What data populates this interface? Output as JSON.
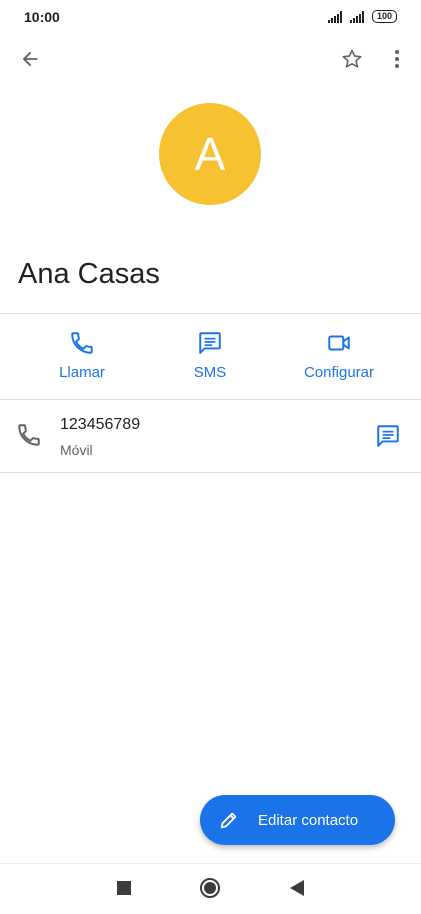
{
  "status_bar": {
    "time": "10:00",
    "battery": "100",
    "icons": [
      "signal-icon",
      "signal-icon",
      "battery-icon"
    ]
  },
  "appbar": {
    "icons": [
      "back-arrow-icon",
      "star-outline-icon",
      "more-vert-icon"
    ]
  },
  "contact": {
    "initial": "A",
    "name": "Ana Casas",
    "avatar_color": "#F6C232"
  },
  "actions": [
    {
      "label": "Llamar",
      "icon": "phone-icon"
    },
    {
      "label": "SMS",
      "icon": "message-icon"
    },
    {
      "label": "Configurar",
      "icon": "videocam-icon"
    }
  ],
  "phone": {
    "number": "123456789",
    "type": "Móvil",
    "icon": "phone-icon",
    "action_icon": "message-icon"
  },
  "fab": {
    "label": "Editar contacto",
    "icon": "pencil-icon"
  },
  "nav": {
    "icons": [
      "recents-square-icon",
      "home-circle-icon",
      "back-triangle-icon"
    ]
  },
  "colors": {
    "accent": "#1a73e8",
    "avatar": "#F6C232",
    "text_primary": "#202124",
    "text_secondary": "#5f6368"
  }
}
